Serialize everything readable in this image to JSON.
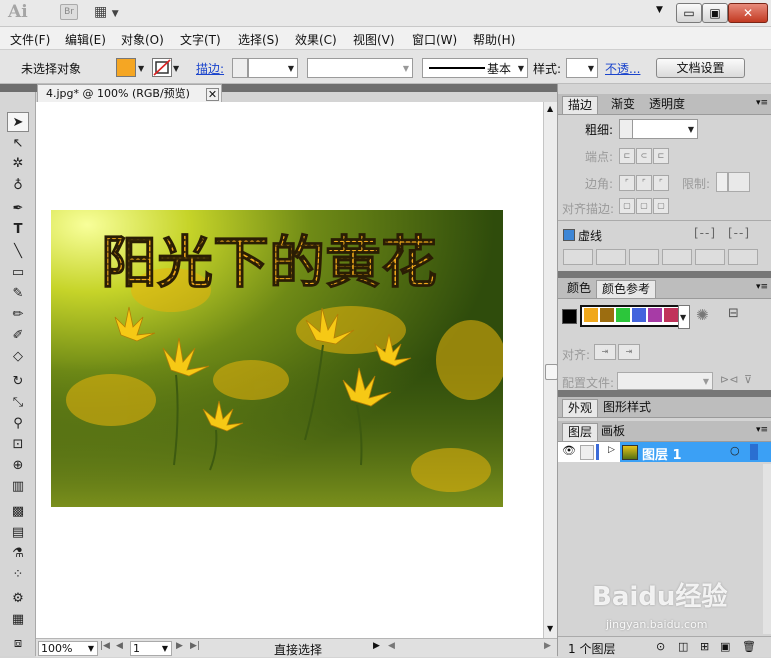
{
  "app": {
    "logo": "Ai",
    "bridge_label": "Br",
    "window_controls": {
      "minimize": "▭",
      "restore": "▣",
      "close": "✕"
    }
  },
  "menu": [
    "文件(F)",
    "编辑(E)",
    "对象(O)",
    "文字(T)",
    "选择(S)",
    "效果(C)",
    "视图(V)",
    "窗口(W)",
    "帮助(H)"
  ],
  "control": {
    "selection_status": "未选择对象",
    "fill_color": "#f5a623",
    "stroke_label": "描边:",
    "stroke_style": "基本",
    "style_label": "样式:",
    "opacity_link": "不透...",
    "doc_setup": "文档设置"
  },
  "document": {
    "tab_title": "4.jpg* @ 100% (RGB/预览)",
    "artwork_text": "阳光下的黄花",
    "zoom": "100%",
    "page": "1",
    "status_tool": "直接选择"
  },
  "stroke_panel": {
    "tabs": [
      "描边",
      "渐变",
      "透明度"
    ],
    "weight_label": "粗细:",
    "cap_label": "端点:",
    "corner_label": "边角:",
    "limit_label": "限制:",
    "align_label": "对齐描边:",
    "dashed_label": "虚线"
  },
  "color_panel": {
    "tabs": [
      "颜色",
      "颜色参考"
    ],
    "swatches": [
      "#f0a81c",
      "#9c6d10",
      "#2cc63b",
      "#4464dd",
      "#a73ba6",
      "#c0335a"
    ],
    "align_label": "对齐:",
    "profile_label": "配置文件:"
  },
  "appearance_panel": {
    "tabs": [
      "外观",
      "图形样式"
    ]
  },
  "layers_panel": {
    "tabs": [
      "图层",
      "画板"
    ],
    "layer_name": "图层 1",
    "count": "1 个图层"
  },
  "watermark": {
    "brand": "Baidu经验",
    "url": "jingyan.baidu.com"
  }
}
